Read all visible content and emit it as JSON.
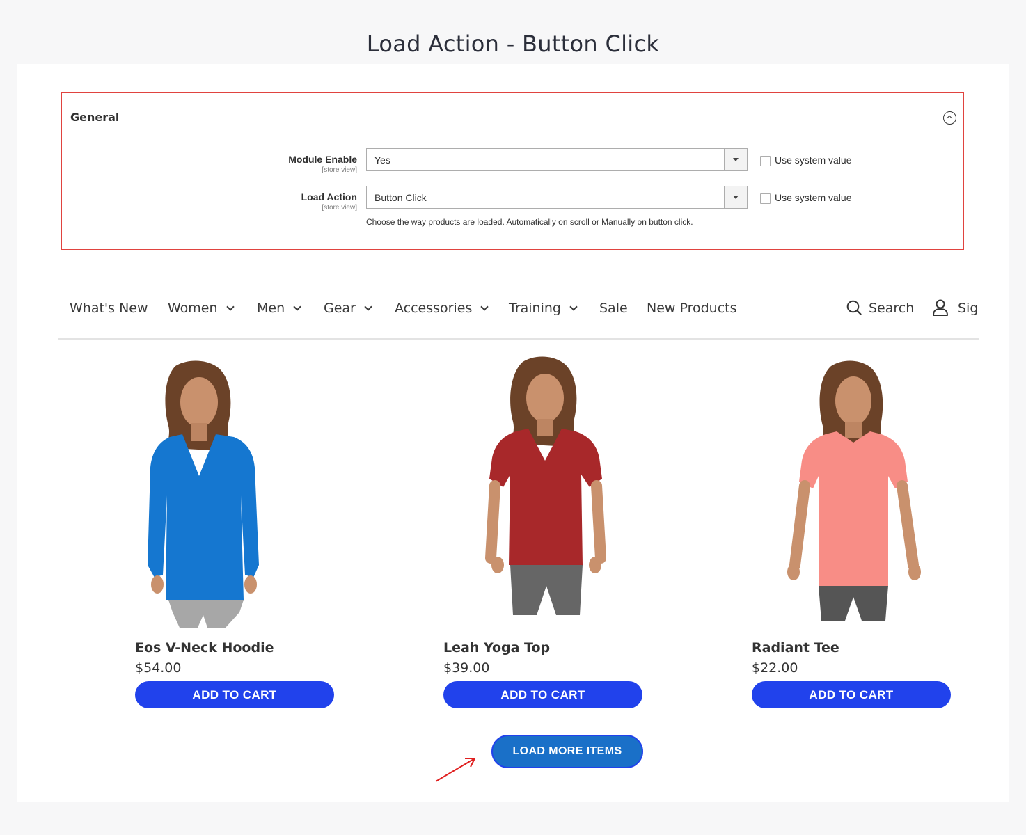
{
  "page": {
    "title": "Load Action - Button Click"
  },
  "config": {
    "section_title": "General",
    "rows": [
      {
        "label": "Module Enable",
        "scope": "[store view]",
        "value": "Yes",
        "use_system_label": "Use system value"
      },
      {
        "label": "Load Action",
        "scope": "[store view]",
        "value": "Button Click",
        "use_system_label": "Use system value"
      }
    ],
    "note": "Choose the way products are loaded. Automatically on scroll or Manually on button click."
  },
  "nav": {
    "items": [
      "What's New",
      "Women",
      "Men",
      "Gear",
      "Accessories",
      "Training",
      "Sale",
      "New Products"
    ],
    "search_label": "Search",
    "sign_label": "Sig"
  },
  "products": [
    {
      "name": "Eos V-Neck Hoodie",
      "price": "$54.00",
      "button": "ADD TO CART",
      "top_color": "#1577d0"
    },
    {
      "name": "Leah Yoga Top",
      "price": "$39.00",
      "button": "ADD TO CART",
      "top_color": "#a8282a"
    },
    {
      "name": "Radiant Tee",
      "price": "$22.00",
      "button": "ADD TO CART",
      "top_color": "#f88d86"
    }
  ],
  "load_more": {
    "label": "LOAD MORE ITEMS"
  },
  "colors": {
    "accent": "#2142ec",
    "load_more": "#1a70c8",
    "highlight": "#e0433f"
  }
}
